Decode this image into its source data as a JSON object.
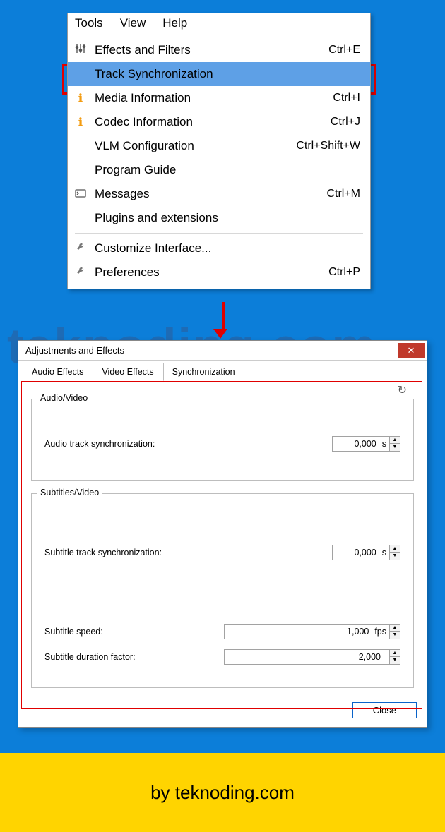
{
  "menubar": {
    "tools": "Tools",
    "view": "View",
    "help": "Help"
  },
  "menu": {
    "effects": {
      "label": "Effects and Filters",
      "shortcut": "Ctrl+E"
    },
    "tracksync": {
      "label": "Track Synchronization",
      "shortcut": ""
    },
    "mediainfo": {
      "label": "Media Information",
      "shortcut": "Ctrl+I"
    },
    "codecinfo": {
      "label": "Codec Information",
      "shortcut": "Ctrl+J"
    },
    "vlm": {
      "label": "VLM Configuration",
      "shortcut": "Ctrl+Shift+W"
    },
    "guide": {
      "label": "Program Guide",
      "shortcut": ""
    },
    "messages": {
      "label": "Messages",
      "shortcut": "Ctrl+M"
    },
    "plugins": {
      "label": "Plugins and extensions",
      "shortcut": ""
    },
    "custom": {
      "label": "Customize Interface...",
      "shortcut": ""
    },
    "prefs": {
      "label": "Preferences",
      "shortcut": "Ctrl+P"
    }
  },
  "fx": {
    "title": "Adjustments and Effects",
    "tabs": {
      "audio": "Audio Effects",
      "video": "Video Effects",
      "sync": "Synchronization"
    },
    "group_av": "Audio/Video",
    "group_sub": "Subtitles/Video",
    "audio_sync_label": "Audio track synchronization:",
    "audio_sync_value": "0,000",
    "audio_sync_unit": "s",
    "sub_sync_label": "Subtitle track synchronization:",
    "sub_sync_value": "0,000",
    "sub_sync_unit": "s",
    "sub_speed_label": "Subtitle speed:",
    "sub_speed_value": "1,000",
    "sub_speed_unit": "fps",
    "sub_dur_label": "Subtitle duration factor:",
    "sub_dur_value": "2,000",
    "sub_dur_unit": "",
    "close": "Close"
  },
  "footer": "by teknoding.com",
  "watermark": "teknoding.com"
}
